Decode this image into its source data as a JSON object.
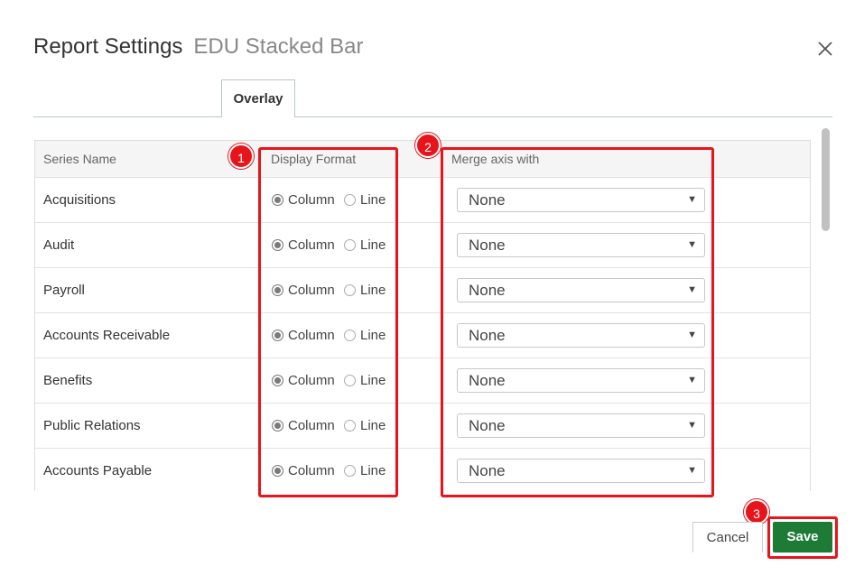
{
  "dialog": {
    "title": "Report Settings",
    "subtitle": "EDU Stacked Bar"
  },
  "tabs": [
    {
      "label": "Overlay",
      "active": true
    }
  ],
  "table": {
    "headers": {
      "series_name": "Series Name",
      "display_format": "Display Format",
      "merge_axis": "Merge axis with"
    },
    "rows": [
      {
        "name": "Acquisitions",
        "format": "Column",
        "column_label": "Column",
        "line_label": "Line",
        "merge": "None"
      },
      {
        "name": "Audit",
        "format": "Column",
        "column_label": "Column",
        "line_label": "Line",
        "merge": "None"
      },
      {
        "name": "Payroll",
        "format": "Column",
        "column_label": "Column",
        "line_label": "Line",
        "merge": "None"
      },
      {
        "name": "Accounts Receivable",
        "format": "Column",
        "column_label": "Column",
        "line_label": "Line",
        "merge": "None"
      },
      {
        "name": "Benefits",
        "format": "Column",
        "column_label": "Column",
        "line_label": "Line",
        "merge": "None"
      },
      {
        "name": "Public Relations",
        "format": "Column",
        "column_label": "Column",
        "line_label": "Line",
        "merge": "None"
      },
      {
        "name": "Accounts Payable",
        "format": "Column",
        "column_label": "Column",
        "line_label": "Line",
        "merge": "None"
      }
    ]
  },
  "callouts": [
    {
      "number": "1"
    },
    {
      "number": "2"
    },
    {
      "number": "3"
    }
  ],
  "footer": {
    "cancel_label": "Cancel",
    "save_label": "Save"
  },
  "colors": {
    "save": "#1e7b36",
    "highlight": "#e8141b"
  },
  "icons": {
    "close": "close-icon",
    "caret": "caret-down-icon"
  }
}
